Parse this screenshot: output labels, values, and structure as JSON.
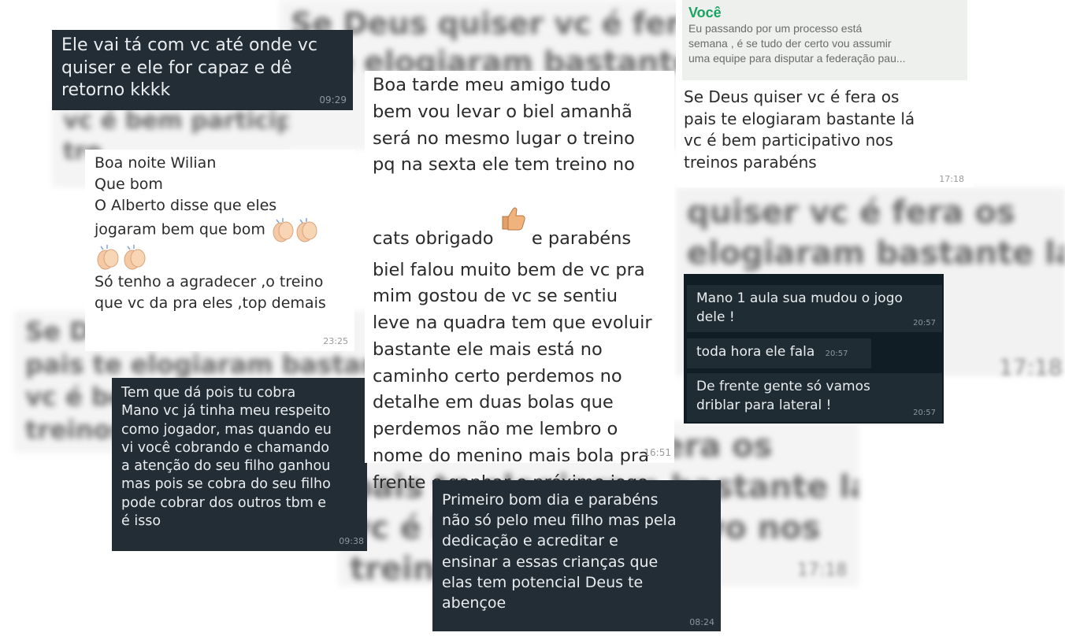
{
  "background_blur": {
    "b1": "Se Deus quiser vc é fera os",
    "b2": "s te elogiaram bastante lá",
    "b3": "quiser vc é fera os",
    "b4": "elogiaram bastante lá",
    "b5": "Se De",
    "b6": "pais te elogiaram bastante l",
    "b7": "vc é be",
    "b8": "treinos",
    "b9": "fera os",
    "b10": "pais te elogiaram bastante lá",
    "b11": "vc é bem participativo nos",
    "b12": "treino",
    "b13": "vc é bem participa",
    "b14": "tre",
    "b15": "17:18",
    "b16": "17:18"
  },
  "messages": {
    "m1": {
      "text": "Ele vai tá com vc até onde vc\nquiser e ele for capaz e dê\nretorno kkkk",
      "time": "09:29"
    },
    "m2": {
      "line1": "Boa noite Wilian\nQue bom\nO Alberto disse que eles",
      "line2": "jogaram bem que bom",
      "line3": "Só tenho a agradecer ,o treino\nque vc da pra eles ,top demais",
      "time": "23:25"
    },
    "m3": {
      "text": "Tem que dá pois tu cobra\nMano vc já tinha meu respeito\ncomo jogador, mas quando eu\nvi você cobrando e chamando\na atenção do seu filho ganhou\nmas pois se cobra do seu filho\npode cobrar dos outros tbm e\né isso",
      "time": "09:38"
    },
    "m4": {
      "part1": "Boa tarde meu amigo tudo\nbem vou levar o biel amanhã\nserá no mesmo lugar o treino\npq na sexta ele tem treino no\ncats obrigado",
      "part2": "e parabéns",
      "part3": "biel falou muito bem de vc pra\nmim gostou de vc se sentiu\nleve na quadra tem que evoluir\nbastante ele mais está no\ncaminho certo perdemos no\ndetalhe em duas bolas que\nperdemos não me lembro o\nnome do menino mais bola pra\nfrente e ganhar o próximo jogo",
      "time": "16:51"
    },
    "m5": {
      "quote_author": "Você",
      "quote_text": "Eu passando por um processo está\nsemana , é se tudo der certo vou assumir\numa equipe para disputar a federação pau...",
      "text": "Se Deus quiser vc é fera os\npais te elogiaram bastante lá\nvc é bem participativo nos\ntreinos parabéns",
      "time": "17:18"
    },
    "m6": {
      "text": "Mano 1 aula sua mudou o jogo\ndele !",
      "time": "20:57"
    },
    "m7": {
      "text": "toda hora ele fala",
      "time": "20:57"
    },
    "m8": {
      "text": "De frente gente só vamos\ndriblar para lateral !",
      "time": "20:57"
    },
    "m9": {
      "text": "Primeiro bom dia e parabéns\nnão só pelo meu filho mas pela\ndedicação e acreditar e\nensinar a essas crianças que\nelas tem potencial Deus te\nabençoe",
      "time": "08:24"
    }
  },
  "icons": {
    "clap": "clapping-hands-emoji",
    "thumbs": "thumbs-up-emoji"
  },
  "colors": {
    "dark_bubble": "#232d36",
    "quote_author": "#1aa361"
  }
}
